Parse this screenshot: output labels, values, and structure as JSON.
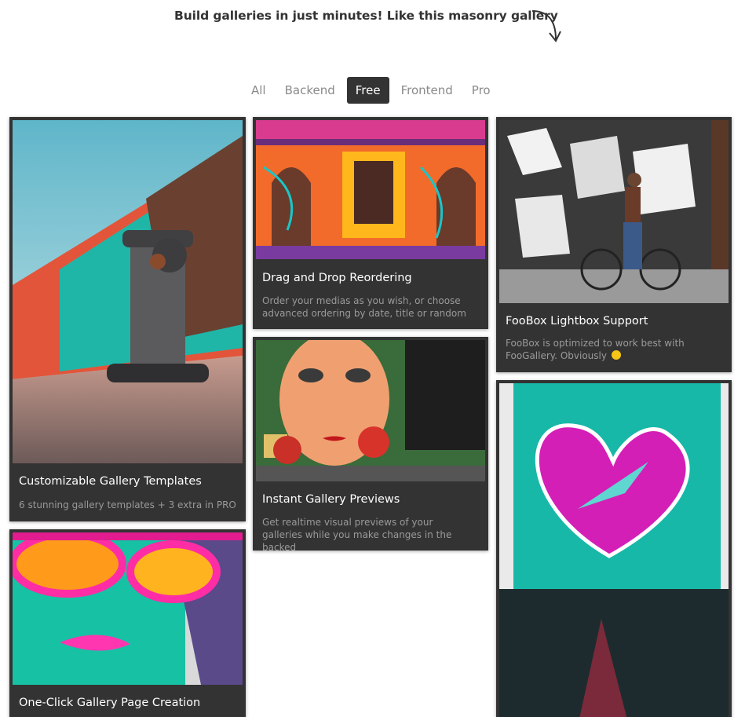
{
  "headline": "Build galleries in just minutes! Like this masonry gallery",
  "filters": [
    {
      "label": "All",
      "active": false
    },
    {
      "label": "Backend",
      "active": false
    },
    {
      "label": "Free",
      "active": true
    },
    {
      "label": "Frontend",
      "active": false
    },
    {
      "label": "Pro",
      "active": false
    }
  ],
  "items": [
    {
      "title": "Customizable Gallery Templates",
      "desc": "6 stunning gallery templates + 3 extra in PRO",
      "image": "fire-hydrant-graffiti-photo"
    },
    {
      "title": "One-Click Gallery Page Creation",
      "desc": "",
      "image": "sunglasses-woman-mural-photo"
    },
    {
      "title": "Drag and Drop Reordering",
      "desc": "Order your medias as you wish, or choose advanced ordering by date, title or random",
      "image": "colorful-facade-photo"
    },
    {
      "title": "Instant Gallery Previews",
      "desc": "Get realtime visual previews of your galleries while you make changes in the backed",
      "image": "mosaic-face-mural-photo"
    },
    {
      "title": "FooBox Lightbox Support",
      "desc": "FooBox is optimized to work best with FooGallery. Obviously",
      "image": "bicycle-graffiti-wall-photo"
    },
    {
      "title": "",
      "desc": "",
      "image": "pink-heart-bird-mural-photo"
    }
  ],
  "colors": {
    "card_bg": "#333333",
    "active_filter_bg": "#333333",
    "filter_text": "#8a8a8a",
    "caption_desc": "#9a9a9a"
  }
}
